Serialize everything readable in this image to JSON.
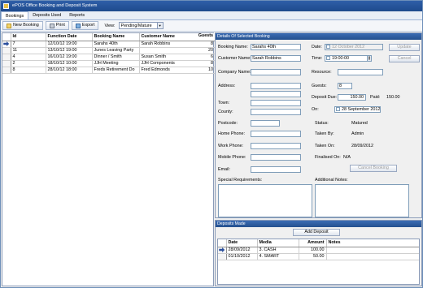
{
  "window": {
    "title": "ePOS Office Booking and Deposit System"
  },
  "menu": [
    "Bookings",
    "Deposits Used",
    "Reports"
  ],
  "toolbar": {
    "new_booking": "New Booking",
    "print": "Print",
    "export": "Export",
    "view_label": "View:",
    "view_value": "Pending/Mature"
  },
  "bookings": {
    "columns": [
      "Id",
      "Function Date",
      "Booking Name",
      "Customer Name",
      "Guests"
    ],
    "rows": [
      {
        "id": "7",
        "date": "12/10/12 19:00",
        "name": "Sarahs 40th",
        "customer": "Sarah Robbins",
        "guests": "8"
      },
      {
        "id": "11",
        "date": "13/10/12 19:00",
        "name": "Junes Leaving Party",
        "customer": "",
        "guests": "20"
      },
      {
        "id": "4",
        "date": "16/10/12 19:00",
        "name": "Dinner / Smith",
        "customer": "Susan Smith",
        "guests": "6"
      },
      {
        "id": "2",
        "date": "18/10/12 10:00",
        "name": "JJH Meeting",
        "customer": "JJH Components",
        "guests": "8"
      },
      {
        "id": "8",
        "date": "28/10/12 18:00",
        "name": "Freds Retirement Do",
        "customer": "Fred Edmonds",
        "guests": "10"
      }
    ]
  },
  "details": {
    "header": "Details Of Selected Booking",
    "booking_name_label": "Booking Name:",
    "booking_name": "Sarahs 40th",
    "customer_name_label": "Customer Name:",
    "customer_name": "Sarah Robbins",
    "company_name_label": "Company Name:",
    "address_label": "Address:",
    "town_label": "Town:",
    "county_label": "County:",
    "postcode_label": "Postcode:",
    "home_phone_label": "Home Phone:",
    "work_phone_label": "Work Phone:",
    "mobile_phone_label": "Mobile Phone:",
    "email_label": "Email:",
    "date_label": "Date:",
    "date_value": "12  October  2012",
    "time_label": "Time:",
    "time_value": "19:00:00",
    "resource_label": "Resource:",
    "guests_label": "Guests:",
    "guests_value": "8",
    "deposit_due_label": "Deposit Due:",
    "deposit_due": "150.00",
    "paid_label": "Paid:",
    "paid_value": "150.00",
    "on_label": "On:",
    "on_value": "28 September 2012",
    "status_label": "Status:",
    "status_value": "Matured",
    "taken_by_label": "Taken By:",
    "taken_by_value": "Admin",
    "taken_on_label": "Taken On:",
    "taken_on_value": "28/09/2012",
    "finalised_label": "Finalised On:",
    "finalised_value": "N/A",
    "special_req_label": "Special Requirements:",
    "additional_notes_label": "Additional Notes:",
    "update_button": "Update",
    "cancel_button": "Cancel",
    "cancel_booking_button": "Cancel Booking"
  },
  "deposits": {
    "header": "Deposits Made",
    "add_button": "Add Deposit",
    "columns": [
      "Date",
      "Media",
      "Amount",
      "Notes"
    ],
    "rows": [
      {
        "date": "28/09/2012",
        "media": "3. CASH",
        "amount": "100.00"
      },
      {
        "date": "01/10/2012",
        "media": "4. SMART",
        "amount": "50.00"
      }
    ]
  }
}
